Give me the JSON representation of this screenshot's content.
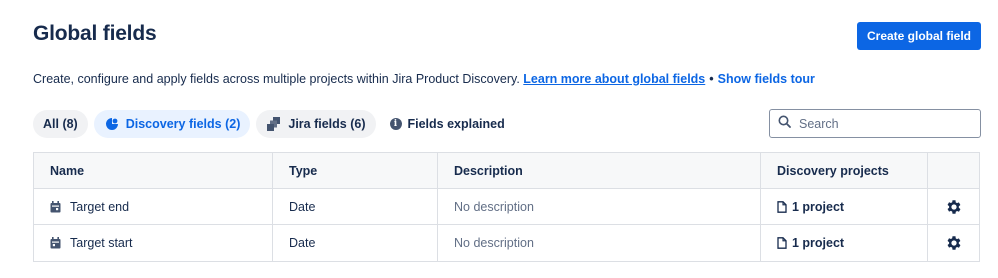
{
  "header": {
    "title": "Global fields",
    "create_button": "Create global field"
  },
  "intro": {
    "text": "Create, configure and apply fields across multiple projects within Jira Product Discovery.",
    "learn_more_link": "Learn more about global fields",
    "separator": "•",
    "tour_link": "Show fields tour"
  },
  "filters": {
    "all": "All (8)",
    "discovery": "Discovery fields (2)",
    "jira": "Jira fields (6)",
    "explained": "Fields explained",
    "active": "discovery"
  },
  "search": {
    "placeholder": "Search",
    "value": ""
  },
  "table": {
    "columns": [
      "Name",
      "Type",
      "Description",
      "Discovery projects"
    ],
    "rows": [
      {
        "name": "Target end",
        "type": "Date",
        "description": "No description",
        "projects": "1 project"
      },
      {
        "name": "Target start",
        "type": "Date",
        "description": "No description",
        "projects": "1 project"
      }
    ]
  },
  "icons": {
    "discovery_pill": "discovery-bulb-icon",
    "jira_pill": "jira-icon",
    "info": "info-icon",
    "search": "search-icon",
    "row_field": "calendar-icon",
    "project": "document-icon",
    "settings": "gear-icon"
  },
  "colors": {
    "primary": "#0c66e4",
    "text": "#172b4d",
    "muted": "#626f86",
    "border": "#dcdfe4",
    "active_pill_bg": "#e9f2ff"
  }
}
